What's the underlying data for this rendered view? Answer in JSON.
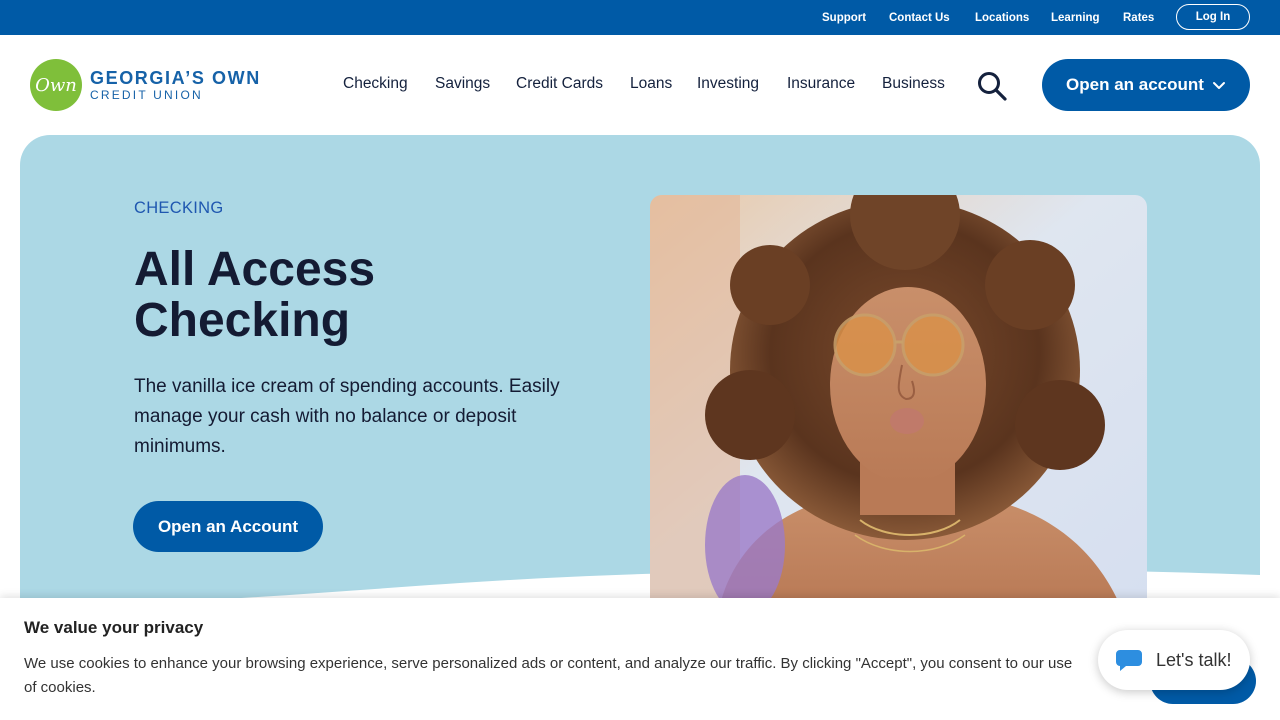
{
  "utility_nav": {
    "links": [
      "Support",
      "Contact Us",
      "Locations",
      "Learning",
      "Rates"
    ],
    "login_label": "Log In"
  },
  "brand": {
    "logo_mark": "Own",
    "name": "GEORGIA’S OWN",
    "subname": "CREDIT UNION",
    "accent_color": "#005aa6",
    "logo_color": "#7fbf3a"
  },
  "main_nav": {
    "items": [
      "Checking",
      "Savings",
      "Credit Cards",
      "Loans",
      "Investing",
      "Insurance",
      "Business"
    ],
    "search_icon": "search-icon",
    "cta_label": "Open an account",
    "cta_icon": "chevron-down-icon"
  },
  "hero": {
    "eyebrow": "CHECKING",
    "title": "All Access Checking",
    "description": "The vanilla ice cream of spending accounts. Easily manage your cash with no balance or deposit minimums.",
    "button_label": "Open an Account",
    "background_color": "#acd8e5"
  },
  "cookie_banner": {
    "title": "We value your privacy",
    "text": "We use cookies to enhance your browsing experience, serve personalized ads or content, and analyze our traffic. By clicking \"Accept\", you consent to our use of cookies."
  },
  "chat": {
    "label": "Let's talk!",
    "icon": "chat-bubble-icon"
  }
}
